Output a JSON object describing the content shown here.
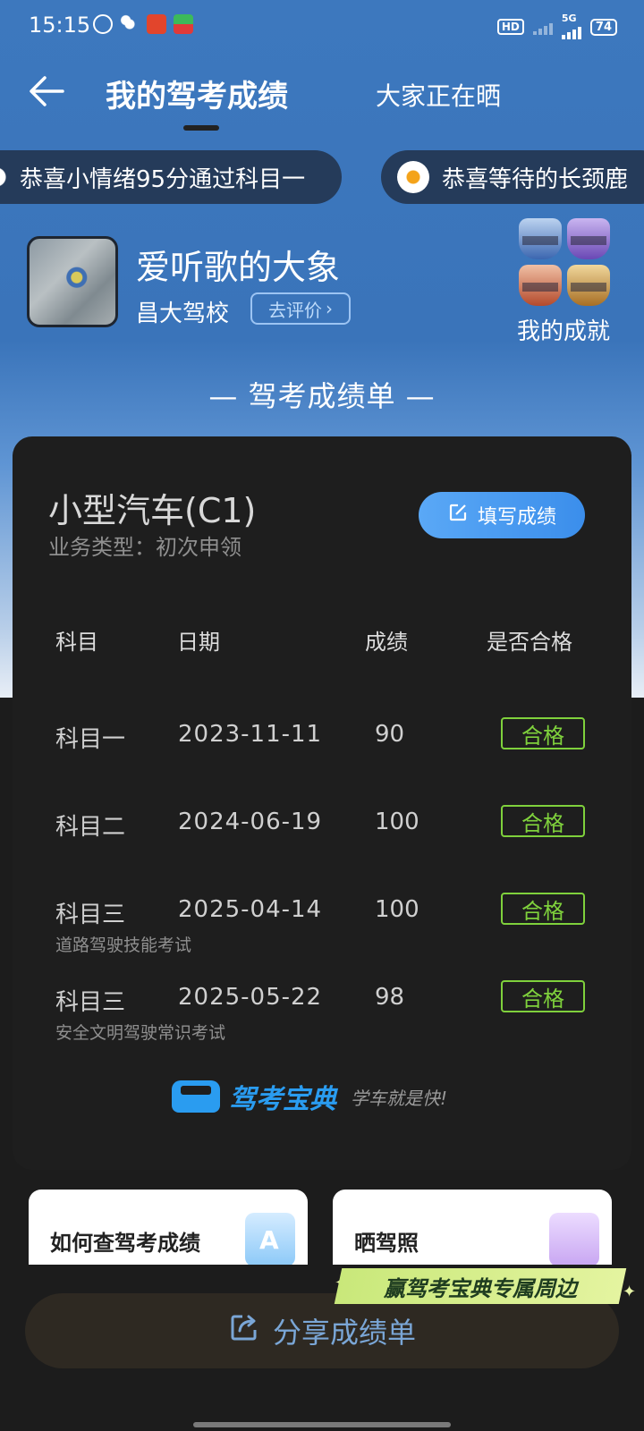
{
  "status_bar": {
    "time": "15:15",
    "battery": "74",
    "hd_label": "HD",
    "network": "5G"
  },
  "header": {
    "title": "我的驾考成绩",
    "other_tab": "大家正在晒"
  },
  "ticker": [
    {
      "text": "恭喜小情绪95分通过科目一"
    },
    {
      "text": "恭喜等待的长颈鹿"
    }
  ],
  "profile": {
    "name": "爱听歌的大象",
    "school": "昌大驾校",
    "rate_button": "去评价",
    "achievements_label": "我的成就"
  },
  "section_title": "— 驾考成绩单 —",
  "card": {
    "vehicle_type": "小型汽车(C1)",
    "business_type": "业务类型：初次申领",
    "fill_button": "填写成绩",
    "columns": [
      "科目",
      "日期",
      "成绩",
      "是否合格"
    ],
    "rows": [
      {
        "subject": "科目一",
        "date": "2023-11-11",
        "score": "90",
        "pass": "合格",
        "sub": ""
      },
      {
        "subject": "科目二",
        "date": "2024-06-19",
        "score": "100",
        "pass": "合格",
        "sub": ""
      },
      {
        "subject": "科目三",
        "date": "2025-04-14",
        "score": "100",
        "pass": "合格",
        "sub": "道路驾驶技能考试"
      },
      {
        "subject": "科目三",
        "date": "2025-05-22",
        "score": "98",
        "pass": "合格",
        "sub": "安全文明驾驶常识考试"
      }
    ],
    "brand": "驾考宝典",
    "slogan": "学车就是快!"
  },
  "tiles": [
    {
      "label": "如何查驾考成绩",
      "icon": "a-letter-icon"
    },
    {
      "label": "晒驾照",
      "icon": "image-icon"
    }
  ],
  "promo": "赢驾考宝典专属周边",
  "share_button": "分享成绩单",
  "colors": {
    "primary_blue": "#3d78be",
    "pass_green": "#7fd13c",
    "card_bg": "#1e1e1e"
  }
}
